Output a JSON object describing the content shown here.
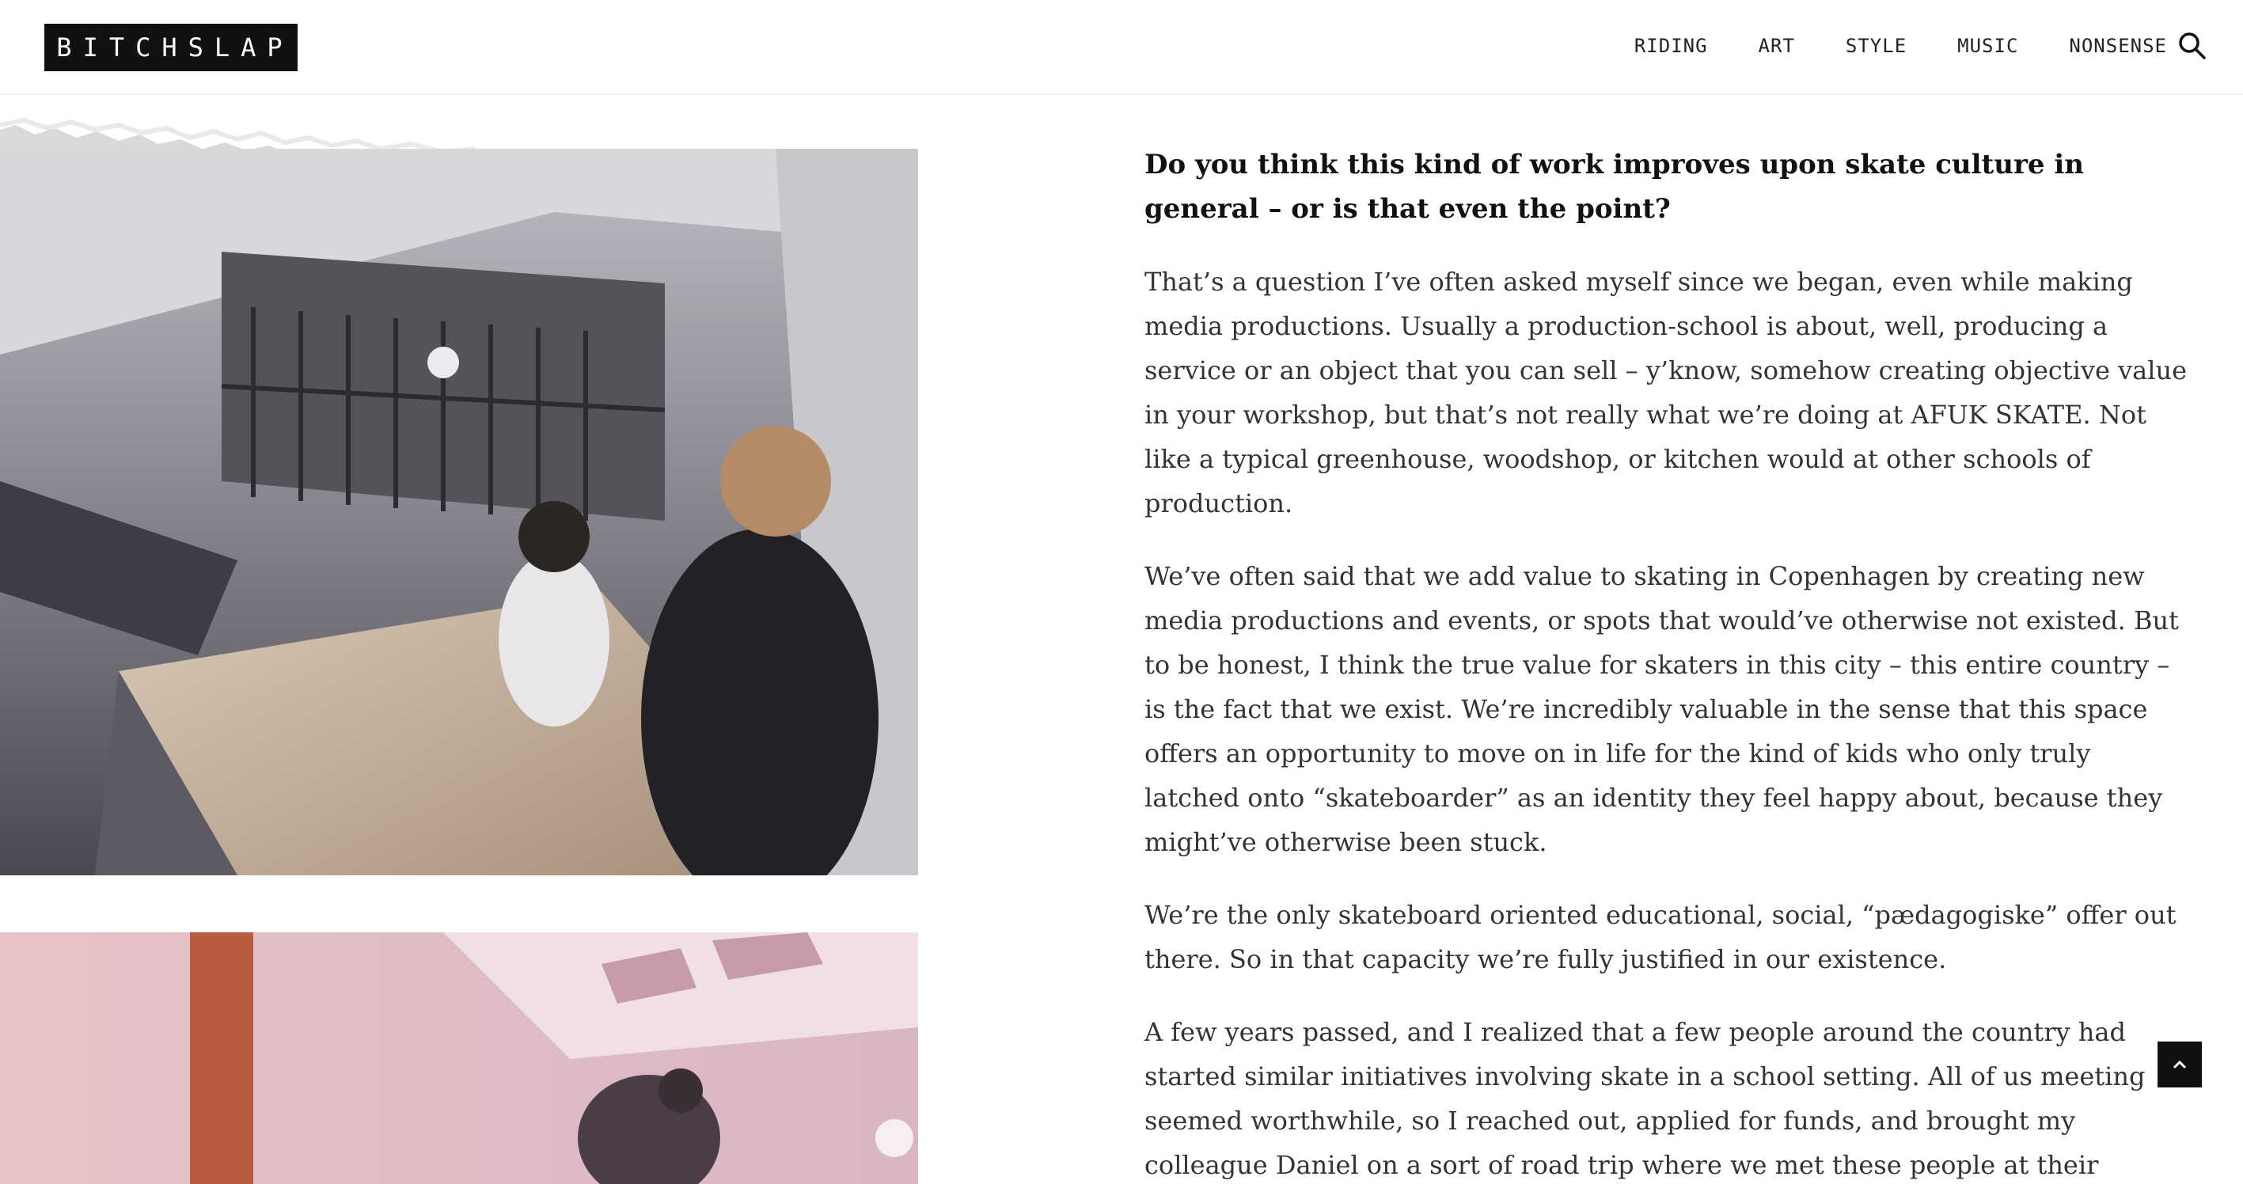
{
  "header": {
    "logo_text": "BITCHSLAP",
    "nav": [
      "RIDING",
      "ART",
      "STYLE",
      "MUSIC",
      "NONSENSE"
    ],
    "search_icon": "search-icon"
  },
  "article": {
    "question": "Do you think this kind of work improves upon skate culture in general – or is that even the point?",
    "paragraphs": [
      "That’s a question I’ve often asked myself since we began, even while making media productions. Usually a production-school is about, well, producing a service or an object that you can sell – y’know, somehow creating objective value in your workshop, but that’s not really what we’re doing at AFUK SKATE. Not like a typical greenhouse, woodshop, or kitchen would at other schools of production.",
      "We’ve often said that we add value to skating in Copenhagen by creating new media productions and events, or spots that would’ve otherwise not existed. But to be honest, I think the true value for skaters in this city – this entire country – is the fact that we exist. We’re incredibly valuable in the sense that this space offers an opportunity to move on in life for the kind of kids who only truly latched onto “skateboarder” as an identity they feel happy about, because they might’ve otherwise been stuck.",
      "We’re the only skateboard oriented educational, social, “pædagogiske” offer out there. So in that capacity we’re fully justified in our existence.",
      "A few years passed, and I realized that a few people around the country had started similar initiatives involving skate in a school setting. All of us meeting seemed worthwhile, so I reached out, applied for funds, and brought my colleague Daniel on a sort of road trip where we met these people at their"
    ]
  },
  "back_to_top": {
    "icon": "chevron-up-icon"
  },
  "colors": {
    "logo_bg": "#111111",
    "text": "#333333",
    "heading": "#111111"
  }
}
